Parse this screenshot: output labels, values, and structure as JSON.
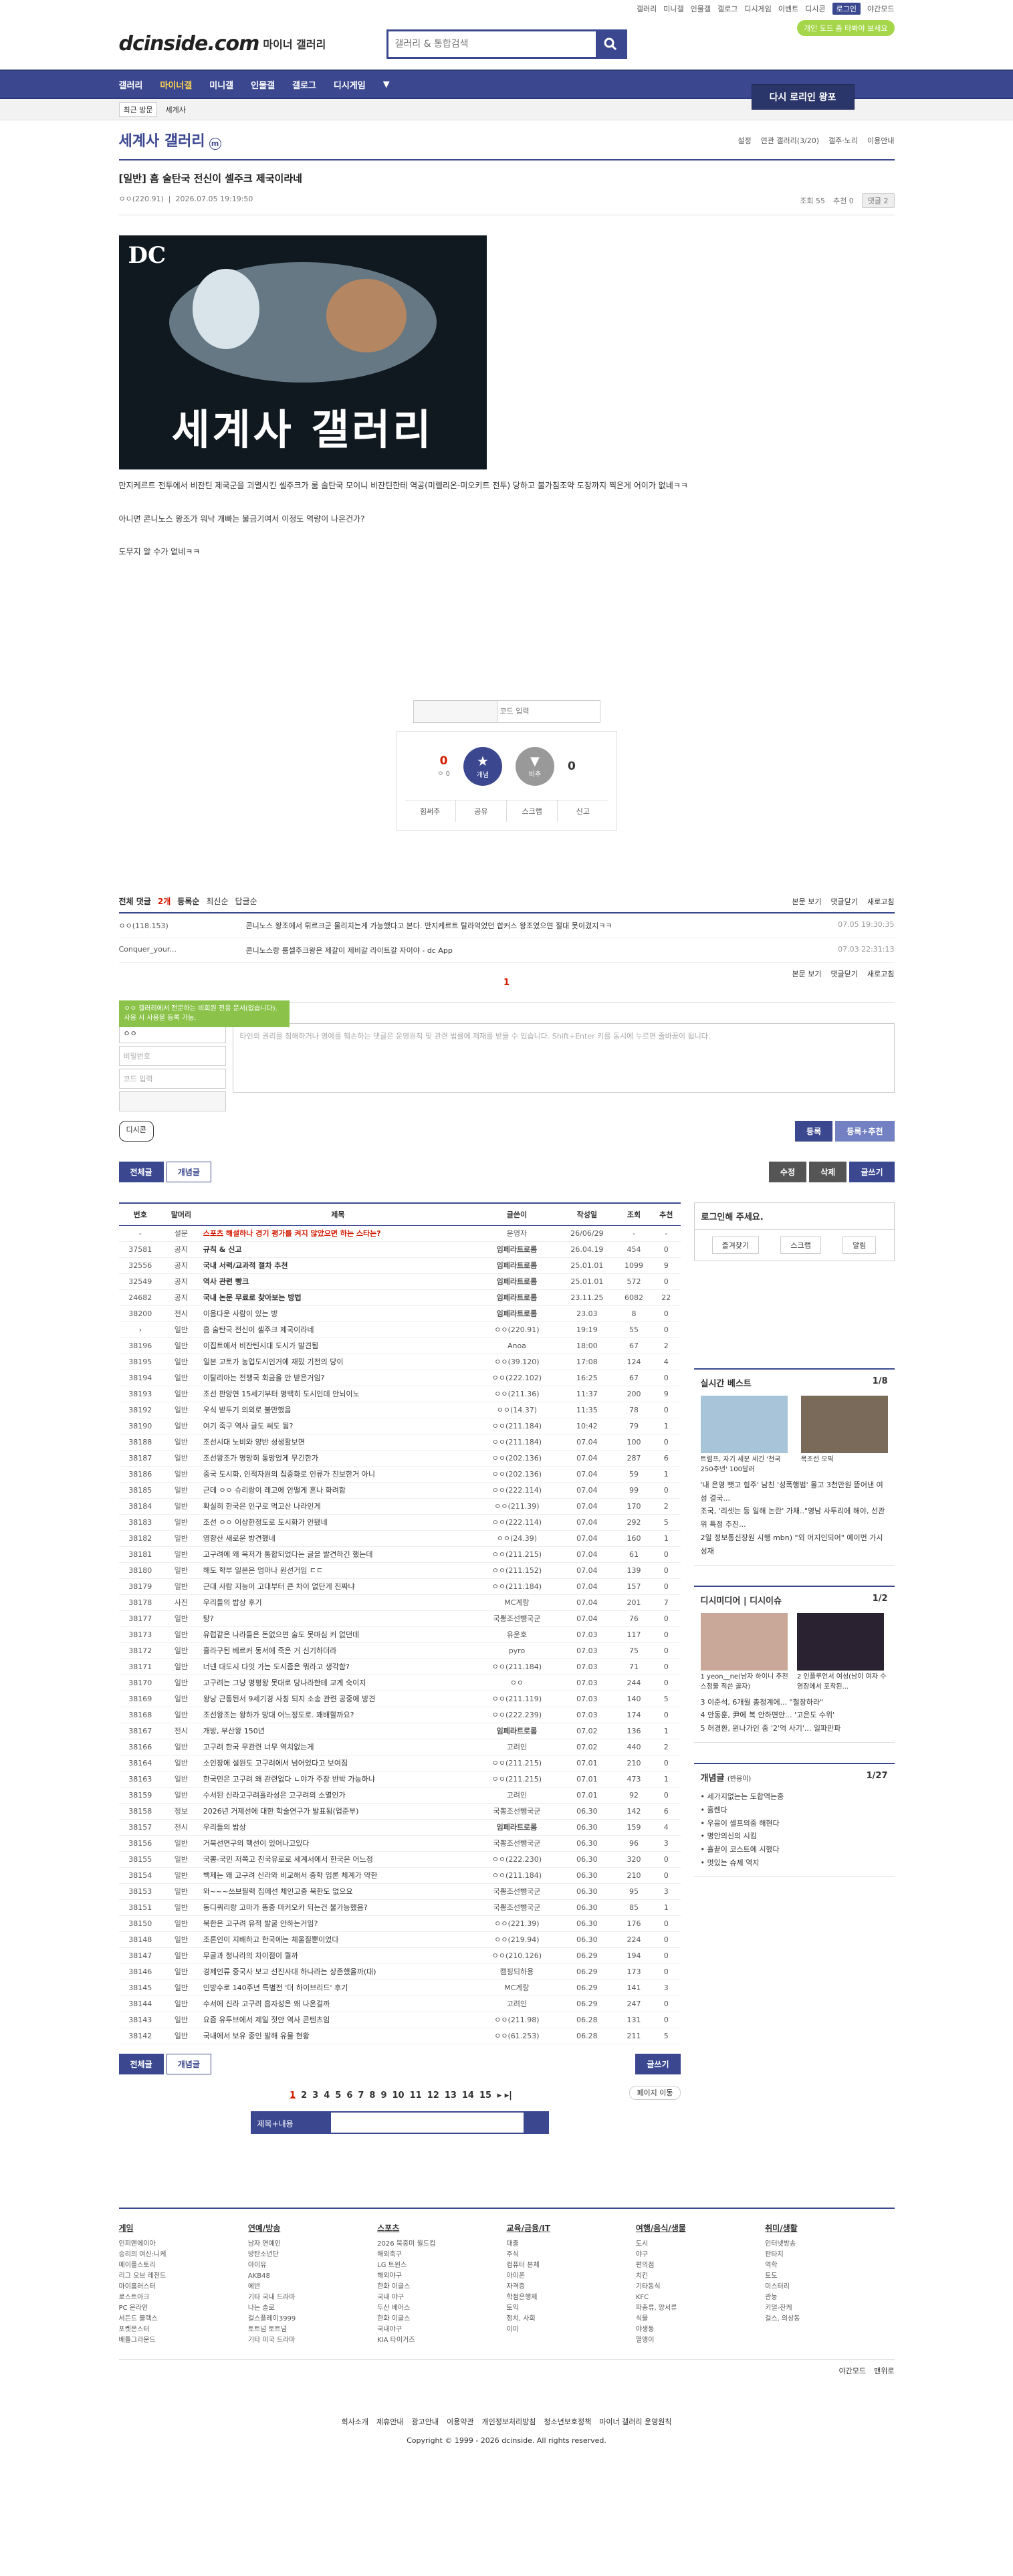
{
  "toplinks": [
    "갤러리",
    "미니갤",
    "인물갤",
    "갤로그",
    "디시게임",
    "이벤트",
    "디시콘",
    "로그인",
    "야간모드"
  ],
  "header": {
    "logo": "dcinside.com",
    "logo_sub": "마이너 갤러리",
    "search_placeholder": "갤러리 & 통합검색",
    "promo": "개인 도드 좀 타봐야 보세요"
  },
  "gnb": {
    "items": [
      "갤러리",
      "마이너갤",
      "미니갤",
      "인물갤",
      "갤로그",
      "디시게임"
    ],
    "right_button": "다시 로리인 왕포"
  },
  "subbar": {
    "recent": "최근 방문",
    "item": "세계사"
  },
  "gallery": {
    "title": "세계사 갤러리",
    "badge": "m",
    "tools": [
      "설정",
      "연관 갤러리(3/20)",
      "갤주·노리",
      "이용안내"
    ]
  },
  "post": {
    "title": "[일반] 흠 술탄국 전신이 셀주크 제국이라네",
    "author": "ㅇㅇ(220.91)",
    "date": "2026.07.05 19:19:50",
    "views": "조회 55",
    "recommend": "추천 0",
    "comment": "댓글 2",
    "banner_dc": "DC",
    "banner_title": "세계사 갤러리",
    "body": [
      "만지케르트 전투에서 비잔틴 제국군을 괴멸시킨 셀주크가 룸 술탄국 모이니 비잔틴한테 역공(미렐리온-미오키트 전투) 당하고 불가침조약 도장까지 찍은게 어이가 없네ㅋㅋ",
      "아니면 콘니노스 왕조가 워낙 개빠는 불금기여서 이정도 역량이 나온건가?",
      "도무지 알 수가 없네ㅋㅋ"
    ]
  },
  "reco": {
    "captcha_placeholder": "코드 입력",
    "up_count": "0",
    "fixed_count": "ㅇ 0",
    "up_label": "개념",
    "down_label": "비추",
    "down_count": "0",
    "footer": [
      "힘써주",
      "공유",
      "스크랩",
      "신고"
    ]
  },
  "comments": {
    "header": [
      "전체 댓글",
      "2개",
      "등록순",
      "최신순",
      "답글순"
    ],
    "right": [
      "본문 보기",
      "댓글닫기",
      "새로고침"
    ],
    "items": [
      {
        "nick": "ㅇㅇ(118.153)",
        "text": "콘니노스 왕조에서 튀르크군 물리치는게 가능했다고 본다. 만지케르트 탈라억었던 합커스 왕조였으면 절대 못이겼지ㅋㅋ",
        "date": "07.05 19:30:35"
      },
      {
        "nick": "Conquer_your...",
        "text": "콘니노스랑 룸셀주크왕은 제갈이 제비갈 라이트갈 자이야 - dc App",
        "date": "07.03 22:31:13"
      }
    ],
    "page": "1",
    "tip": "ㅇㅇ 갤러리에서 전문하는 비회원 전용 문서(없습니다). 사용 시 사용을 등록 가능.",
    "nick_value": "ㅇㅇ",
    "pw_placeholder": "비밀번호",
    "code_placeholder": "코드 입력",
    "textarea": "타인의 권리를 침해하거나 명예를 훼손하는 댓글은 운영원칙 및 관련 법률에 제재를 받을 수 있습니다. Shift+Enter 키를 동시에 누르면 줄바꿈이 됩니다.",
    "dccon": "디시콘",
    "submit": "등록",
    "submit_reco": "등록+추천"
  },
  "buttons": {
    "all": "전체글",
    "concept": "개념글",
    "edit": "수정",
    "delete": "삭제",
    "write": "글쓰기"
  },
  "table": {
    "headers": [
      "번호",
      "말머리",
      "제목",
      "글쓴이",
      "작성일",
      "조회",
      "추천"
    ],
    "rows": [
      [
        "-",
        "설문",
        "스포츠 해설하나 경기 평가를 켜지 않았으면 하는 스타는?",
        "운영자",
        "26/06/29",
        "-",
        "-"
      ],
      [
        "37581",
        "공지",
        "규칙 & 신고",
        "임페라트로롬",
        "26.04.19",
        "454",
        "0"
      ],
      [
        "32556",
        "공지",
        "국내 서력/교과적 절차 추천",
        "임페라트로롬",
        "25.01.01",
        "1099",
        "9"
      ],
      [
        "32549",
        "공지",
        "역사 관련 빵크",
        "임페라트로롬",
        "25.01.01",
        "572",
        "0"
      ],
      [
        "24682",
        "공지",
        "국내 논문 무료로 찾아보는 방법",
        "임페라트로롬",
        "23.11.25",
        "6082",
        "22"
      ],
      [
        "38200",
        "전시",
        "이음다운 사람이 있는 방",
        "임페라트로롬",
        "23.03",
        "8",
        "0"
      ],
      [
        "›",
        "일반",
        "흠 술탄국 전신이 셀주크 제국이라네",
        "ㅇㅇ(220.91)",
        "19:19",
        "55",
        "0"
      ],
      [
        "38196",
        "일반",
        "이집트에서 비잔틴시대 도시가 발견됨",
        "Anoa",
        "18:00",
        "67",
        "2"
      ],
      [
        "38195",
        "일반",
        "일본 고토가 농업도시인거에 재밌 기전의 당이",
        "ㅇㅇ(39.120)",
        "17:08",
        "124",
        "4"
      ],
      [
        "38194",
        "일반",
        "이탈리아는 전쟁국 회금을 안 받은거임?",
        "ㅇㅇ(222.102)",
        "16:25",
        "67",
        "0"
      ],
      [
        "38193",
        "일반",
        "조선 판앙연 15세기부터 명백히 도시인데 안뇌이노",
        "ㅇㅇ(211.36)",
        "11:37",
        "200",
        "9"
      ],
      [
        "38192",
        "일반",
        "우식 받두기 의외로 불만했음",
        "ㅇㅇ(14.37)",
        "11:35",
        "78",
        "0"
      ],
      [
        "38190",
        "일반",
        "여기 죽구 역사 글도 써도 됨?",
        "ㅇㅇ(211.184)",
        "10:42",
        "79",
        "1"
      ],
      [
        "38188",
        "일반",
        "조선시대 노비와 양반 성생활보면",
        "ㅇㅇ(211.184)",
        "07.04",
        "100",
        "0"
      ],
      [
        "38187",
        "일반",
        "조선왕조가 명망히 통망었게 무긴한가",
        "ㅇㅇ(202.136)",
        "07.04",
        "287",
        "6"
      ],
      [
        "38186",
        "일반",
        "중국 도시화, 인적자원의 집중화로 인류가 진보한거 아니",
        "ㅇㅇ(202.136)",
        "07.04",
        "59",
        "1"
      ],
      [
        "38185",
        "일반",
        "근데 ㅇㅇ 슈리랑이 레고에 안떨게 혼나 화려함",
        "ㅇㅇ(222.114)",
        "07.04",
        "99",
        "0"
      ],
      [
        "38184",
        "일반",
        "확실히 한국은 인구로 먹고산 나라인게",
        "ㅇㅇ(211.39)",
        "07.04",
        "170",
        "2"
      ],
      [
        "38183",
        "일반",
        "조선 ㅇㅇ 이상한정도로 도시화가 안됐네",
        "ㅇㅇ(222.114)",
        "07.04",
        "292",
        "5"
      ],
      [
        "38182",
        "일반",
        "영향산 새로운 방견했네",
        "ㅇㅇ(24.39)",
        "07.04",
        "160",
        "1"
      ],
      [
        "38181",
        "일반",
        "고구려에 왜 옥저가 통합되었다는 글을 발견하긴 했는데",
        "ㅇㅇ(211.215)",
        "07.04",
        "61",
        "0"
      ],
      [
        "38180",
        "일반",
        "해도 학부 일본은 엄마나 원선거임 ㄷㄷ",
        "ㅇㅇ(211.152)",
        "07.04",
        "139",
        "0"
      ],
      [
        "38179",
        "일반",
        "근대 사람 지능이 고대부터 큰 차이 없단게 진짜냐",
        "ㅇㅇ(211.184)",
        "07.04",
        "157",
        "0"
      ],
      [
        "38178",
        "사진",
        "우리들의 밥상 후기",
        "MC계랑",
        "07.04",
        "201",
        "7"
      ],
      [
        "38177",
        "일반",
        "탕?",
        "국뽕조선뺑국군",
        "07.04",
        "76",
        "0"
      ],
      [
        "38173",
        "일반",
        "유럽같은 나라들은 돈없으면 술도 못마심 커 없던데",
        "유운호",
        "07.03",
        "117",
        "0"
      ],
      [
        "38172",
        "일반",
        "흘라구된 베르커 동서에 죽은 거 신기하더라",
        "pyro",
        "07.03",
        "75",
        "0"
      ],
      [
        "38171",
        "일반",
        "너넨 대도시 다잇 가는 도시좀은 뭐라고 생각함?",
        "ㅇㅇ(211.184)",
        "07.03",
        "71",
        "0"
      ],
      [
        "38170",
        "일반",
        "고구려는 그냥 명평왕 못대로 당나라한테 교계 숙이지",
        "ㅇㅇ",
        "07.03",
        "244",
        "0"
      ],
      [
        "38169",
        "일반",
        "왕낭 근통된서 9세기경 사칭 되지 소송 관련 공중에 방견",
        "ㅇㅇ(211.119)",
        "07.03",
        "140",
        "5"
      ],
      [
        "38168",
        "일반",
        "조선왕조는 왕하가 망대 어느정도로. 꽤배할까요?",
        "ㅇㅇ(222.239)",
        "07.03",
        "174",
        "0"
      ],
      [
        "38167",
        "전시",
        "개방, 부산왕 150년",
        "임페라트로롬",
        "07.02",
        "136",
        "1"
      ],
      [
        "38166",
        "일반",
        "고구려 한국 무관련 너무 역치없는게",
        "고려인",
        "07.02",
        "440",
        "2"
      ],
      [
        "38164",
        "일반",
        "소인장에 설원도 고구려에서 넘어었다고 보여짐",
        "ㅇㅇ(211.215)",
        "07.01",
        "210",
        "0"
      ],
      [
        "38163",
        "일반",
        "한국민은 고구려 왜 관련없다 ㄴ야가 주장 반박 가능하냐",
        "ㅇㅇ(211.215)",
        "07.01",
        "473",
        "1"
      ],
      [
        "38159",
        "일반",
        "수서된 신라고구려흘라성은 고구려의 소멸인가",
        "고려인",
        "07.01",
        "92",
        "0"
      ],
      [
        "38158",
        "정보",
        "2026년 거제선에 대한 학술연구가 발표됨(업준부)",
        "국뽕조선뺑국군",
        "06.30",
        "142",
        "6"
      ],
      [
        "38157",
        "전시",
        "우리들의 밥상",
        "임페라트로롬",
        "06.30",
        "159",
        "4"
      ],
      [
        "38156",
        "일반",
        "거북선연구의 핵선이 있어나고있다",
        "국뽕조선뺑국군",
        "06.30",
        "96",
        "3"
      ],
      [
        "38155",
        "일반",
        "국뽕-국민 저쪽고 친국유로로 세계서에서 한국은 어느정",
        "ㅇㅇ(222.230)",
        "06.30",
        "320",
        "0"
      ],
      [
        "38154",
        "일반",
        "백제는 왜 고구려 신라와 비교해서 중학 입론 체계가 약한",
        "ㅇㅇ(211.184)",
        "06.30",
        "210",
        "0"
      ],
      [
        "38153",
        "일반",
        "와~~~쓰브필력 집에선 체인고중 북한도 없으요",
        "국뽕조선뺑국군",
        "06.30",
        "95",
        "3"
      ],
      [
        "38151",
        "일반",
        "동디쿼리랑 고마가 똥중 마커오카 되는건 불가능했음?",
        "국뽕조선뺑국군",
        "06.30",
        "85",
        "1"
      ],
      [
        "38150",
        "일반",
        "북한은 고구려 유적 발굴 안하는거임?",
        "ㅇㅇ(221.39)",
        "06.30",
        "176",
        "0"
      ],
      [
        "38148",
        "일반",
        "조론인이 지배하고 한국에는 체울질뿐이었다",
        "ㅇㅇ(219.94)",
        "06.30",
        "224",
        "0"
      ],
      [
        "38147",
        "일반",
        "무굴과 청나라의 차이점이 뭘까",
        "ㅇㅇ(210.126)",
        "06.29",
        "194",
        "0"
      ],
      [
        "38146",
        "일반",
        "경제인류 중국사 보고 선진사대 하나라는 상존했을까(대)",
        "캠핑되하용",
        "06.29",
        "173",
        "0"
      ],
      [
        "38145",
        "일반",
        "인방수로 140주년 특별전 '더 하이브리드' 후기",
        "MC계랑",
        "06.29",
        "141",
        "3"
      ],
      [
        "38144",
        "일반",
        "수서에 신라 고구려 흡자성은 왜 나온걸까",
        "고려인",
        "06.29",
        "247",
        "0"
      ],
      [
        "38143",
        "일반",
        "요즘 유투브에서 제일 젓안 역사 콘텐츠임",
        "ㅇㅇ(211.98)",
        "06.28",
        "131",
        "0"
      ],
      [
        "38142",
        "일반",
        "국내에서 보유 중인 발해 유물 현황",
        "ㅇㅇ(61.253)",
        "06.28",
        "211",
        "5"
      ]
    ]
  },
  "side": {
    "login_title": "로그인해 주세요.",
    "login_btns": [
      "즐겨찾기",
      "스크랩",
      "알림"
    ],
    "best_title": "실시간 베스트",
    "best_page": "1/8",
    "best_items": [
      "'내 은영 뺏고 힘주' 남친 '성폭행범' 몰고 3천만원 뜯어낸 여성 결국...",
      "조국, '리셋는 등 일해 논란' 가채..\"영남 사투리에 해야, 선관위 특정 추진...",
      "2일 정보통신장원 시행 mbn) \"외 어지인되어\" 예이먼 가시 성재"
    ],
    "best_thumb": [
      "트럼프, 자기 세분 세긴 '천국 250주년' 100달러",
      "목조선 오픽"
    ],
    "dc_title": "디시미디어",
    "dc_title2": "디시이슈",
    "dc_page": "1/2",
    "dc_thumb": [
      "1 yeon__ne(남자 하이니 추천 스정불 적쓴 골자)",
      "2 인플루언서 여성(남이 여자 수영장에서 포착된..."
    ],
    "dc_items": [
      "3 이준석, 6개월 총정계에... \"철장하라\"",
      "4 안동훈, 尹에 복 안하면안... '고은도 수위'",
      "5 허경환, 윈나가인 중 '2'억 사기'... 일파만파"
    ],
    "concept_title": "개념글",
    "concept_sub": "(반응이)",
    "concept_page": "1/27",
    "concept_items": [
      "• 세가지없는는 도합역는중",
      "• 흘렌다",
      "• 우응이 셀프의중 해현다",
      "• 명안의신의 시킴",
      "• 흘끝이 코스트에 시했다",
      "• 멋있는 슈제 역지"
    ]
  },
  "pagination": [
    "1",
    "2",
    "3",
    "4",
    "5",
    "6",
    "7",
    "8",
    "9",
    "10",
    "11",
    "12",
    "13",
    "14",
    "15"
  ],
  "page_move": "페이지 이동",
  "bsearch": "제목+내용",
  "footer": {
    "cols": [
      {
        "t": "게임",
        "i": [
          "인피엔에이아",
          "승리의 여신:니케",
          "메이플스토리",
          "리그 오브 레전드",
          "마이홈러스터",
          "로스트아크",
          "PC 온라인",
          "서든드 불렉스",
          "포켓몬스터",
          "배틀그라운드"
        ]
      },
      {
        "t": "연예/방송",
        "i": [
          "남자 연예인",
          "방탄소년단",
          "아이유",
          "AKB48",
          "에반",
          "기타 국내 드라마",
          "나는 솔로",
          "걸스플레이3999",
          "토트넘 토트넘",
          "기타 미국 드라마"
        ]
      },
      {
        "t": "스포츠",
        "i": [
          "2026 북중미 월드컵",
          "해외축구",
          "LG 트윈스",
          "해외야구",
          "한화 이글스",
          "국내 야구",
          "두산 베어스",
          "한화 이글스",
          "국내야구",
          "KIA 타이거즈"
        ]
      },
      {
        "t": "교육/금융/IT",
        "i": [
          "대출",
          "주식",
          "컴퓨터 본체",
          "아이폰",
          "자격증",
          "학점은행제",
          "토익",
          "정치, 사회",
          "이미"
        ]
      },
      {
        "t": "여행/음식/생물",
        "i": [
          "도시",
          "야구",
          "편의점",
          "치킨",
          "기타동식",
          "KFC",
          "파충류, 양서류",
          "식물",
          "야생동",
          "열앵이"
        ]
      },
      {
        "t": "취미/생활",
        "i": [
          "인터넷방송",
          "판타지",
          "역학",
          "토도",
          "미스터리",
          "관능",
          "키덜-잔케",
          "걸스, 의상동"
        ]
      }
    ],
    "right": [
      "야간모드",
      "맨위로"
    ],
    "links": [
      "회사소개",
      "제휴안내",
      "광고안내",
      "이용약관",
      "개인정보처리방침",
      "청소년보호정책",
      "마이너 갤러리 운영원칙"
    ],
    "copyright": "Copyright © 1999 - 2026 dcinside. All rights reserved."
  }
}
